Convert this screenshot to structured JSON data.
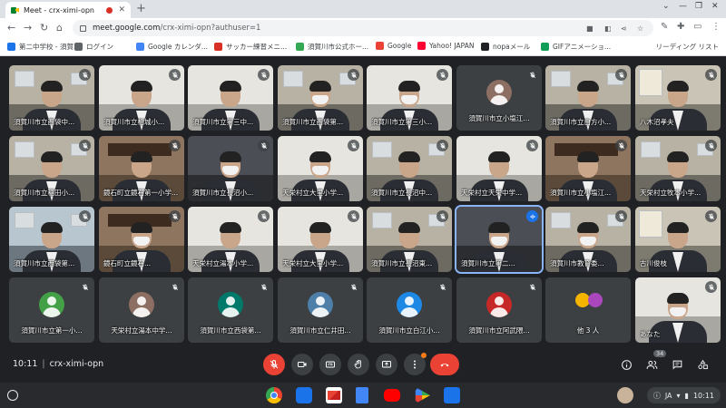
{
  "browser": {
    "tab_title": "Meet - crx-ximi-opn",
    "tab_close": "✕",
    "new_tab": "+",
    "window_controls": [
      "⌄",
      "—",
      "❐",
      "✕"
    ],
    "url_host": "meet.google.com",
    "url_path": "/crx-ximi-opn?authuser=1"
  },
  "bookmarks": [
    {
      "label": "第二中学校 - 須賀...",
      "color": "#1a73e8"
    },
    {
      "label": "ログイン",
      "color": "#5f6368"
    },
    {
      "label": "Google カレンダ...",
      "color": "#4285f4"
    },
    {
      "label": "サッカー練習メニ...",
      "color": "#d93025"
    },
    {
      "label": "須賀川市公式ホー...",
      "color": "#34a853"
    },
    {
      "label": "Google",
      "color": "#ea4335"
    },
    {
      "label": "Yahoo! JAPAN",
      "color": "#ff0033"
    },
    {
      "label": "nopaメール",
      "color": "#202124"
    },
    {
      "label": "GIFアニメーショ...",
      "color": "#0f9d58"
    }
  ],
  "reading_list": "リーディング リスト",
  "meeting": {
    "time": "10:11",
    "code": "crx-ximi-opn",
    "participant_count": "34"
  },
  "tiles": [
    {
      "label": "須賀川市立西袋中...",
      "type": "video",
      "scene": "office",
      "mask": false
    },
    {
      "label": "須賀川市立柏城小...",
      "type": "video",
      "scene": "white",
      "mask": false
    },
    {
      "label": "須賀川市立第三中...",
      "type": "video",
      "scene": "white",
      "mask": false
    },
    {
      "label": "須賀川市立西袋第...",
      "type": "video",
      "scene": "office",
      "mask": true
    },
    {
      "label": "須賀川市立第三小...",
      "type": "video",
      "scene": "white",
      "mask": true
    },
    {
      "label": "須賀川市立小塩江...",
      "type": "avatar",
      "avatar_color": "#8d6e63"
    },
    {
      "label": "須賀川市立白方小...",
      "type": "video",
      "scene": "office",
      "mask": false
    },
    {
      "label": "八木沼孝夫",
      "type": "video",
      "scene": "cabinet",
      "mask": false
    },
    {
      "label": "須賀川市立稲田小...",
      "type": "video",
      "scene": "office",
      "mask": false
    },
    {
      "label": "鏡石町立鏡石第一小学...",
      "type": "video",
      "scene": "wood",
      "mask": false
    },
    {
      "label": "須賀川市立長沼小...",
      "type": "video",
      "scene": "dark",
      "mask": true
    },
    {
      "label": "天栄村立大里小学...",
      "type": "video",
      "scene": "white",
      "mask": true
    },
    {
      "label": "須賀川市立長沼中...",
      "type": "video",
      "scene": "office",
      "mask": false
    },
    {
      "label": "天栄村立天栄中学...",
      "type": "video",
      "scene": "white",
      "mask": false
    },
    {
      "label": "須賀川市立小塩江...",
      "type": "video",
      "scene": "wood",
      "mask": false
    },
    {
      "label": "天栄村立牧本小学...",
      "type": "video",
      "scene": "office",
      "mask": false
    },
    {
      "label": "須賀川市立西袋第...",
      "type": "video",
      "scene": "poster",
      "mask": false
    },
    {
      "label": "鏡石町立鏡石...",
      "type": "video",
      "scene": "wood",
      "mask": true
    },
    {
      "label": "天栄村立湯本小学...",
      "type": "video",
      "scene": "white",
      "mask": false
    },
    {
      "label": "天栄村立大里小学...",
      "type": "video",
      "scene": "white",
      "mask": false
    },
    {
      "label": "須賀川市立長沼東...",
      "type": "video",
      "scene": "office",
      "mask": false
    },
    {
      "label": "須賀川市立第二...",
      "type": "video",
      "scene": "dark",
      "mask": true,
      "speaking": true
    },
    {
      "label": "須賀川市教育委...",
      "type": "video",
      "scene": "office",
      "mask": true
    },
    {
      "label": "古川俊枝",
      "type": "video",
      "scene": "cabinet",
      "mask": false
    },
    {
      "label": "須賀川市立第一小...",
      "type": "avatar",
      "avatar_color": "#43a047"
    },
    {
      "label": "天栄村立湯本中学...",
      "type": "avatar",
      "avatar_color": "#8d6e63"
    },
    {
      "label": "須賀川市立西袋第...",
      "type": "avatar",
      "avatar_color": "#00796b"
    },
    {
      "label": "須賀川市立仁井田...",
      "type": "avatar",
      "avatar_color": "#4e7fa8"
    },
    {
      "label": "須賀川市立白江小...",
      "type": "avatar",
      "avatar_color": "#1e88e5"
    },
    {
      "label": "須賀川市立阿武隈...",
      "type": "avatar",
      "avatar_color": "#c62828"
    },
    {
      "label": "他 3 人",
      "type": "others"
    },
    {
      "label": "あなた",
      "type": "video",
      "scene": "white",
      "mask": true
    }
  ],
  "colors": {
    "meet_bg": "#202124",
    "accent_blue": "#8ab4f8",
    "hangup_red": "#ea4335"
  },
  "shelf": {
    "tray_lang": "JA",
    "tray_time": "10:11"
  }
}
